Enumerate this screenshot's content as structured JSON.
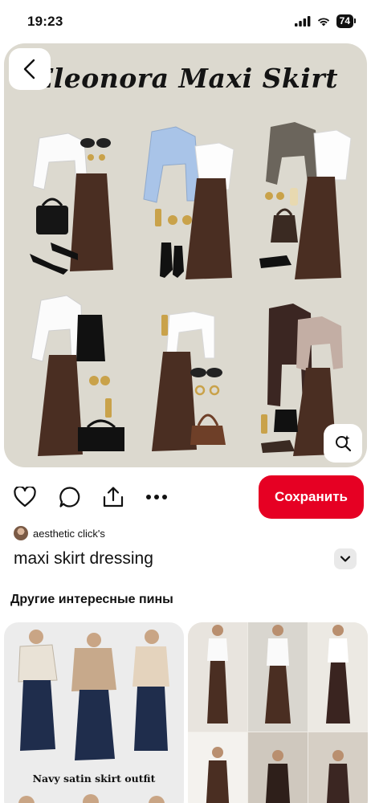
{
  "status_bar": {
    "time": "19:23",
    "battery": "74",
    "icons": [
      "signal-icon",
      "wifi-icon",
      "battery-icon"
    ]
  },
  "pin": {
    "image_title": "Eleonora Maxi Skirt",
    "back_icon": "chevron-left-icon",
    "lens_icon": "visual-search-icon"
  },
  "actions": {
    "icons": [
      "heart-icon",
      "comment-icon",
      "share-icon",
      "more-icon"
    ],
    "save_label": "Сохранить"
  },
  "author": {
    "name": "aesthetic click's"
  },
  "description": {
    "title": "maxi skirt dressing",
    "expand_icon": "chevron-down-icon"
  },
  "more_pins": {
    "heading": "Другие интересные пины",
    "items": [
      {
        "caption": "Navy satin skirt outfit"
      },
      {
        "caption": ""
      }
    ]
  },
  "colors": {
    "accent": "#e60023",
    "pin_background": "#dcd9cf",
    "skirt_brown": "#4a2e22"
  }
}
